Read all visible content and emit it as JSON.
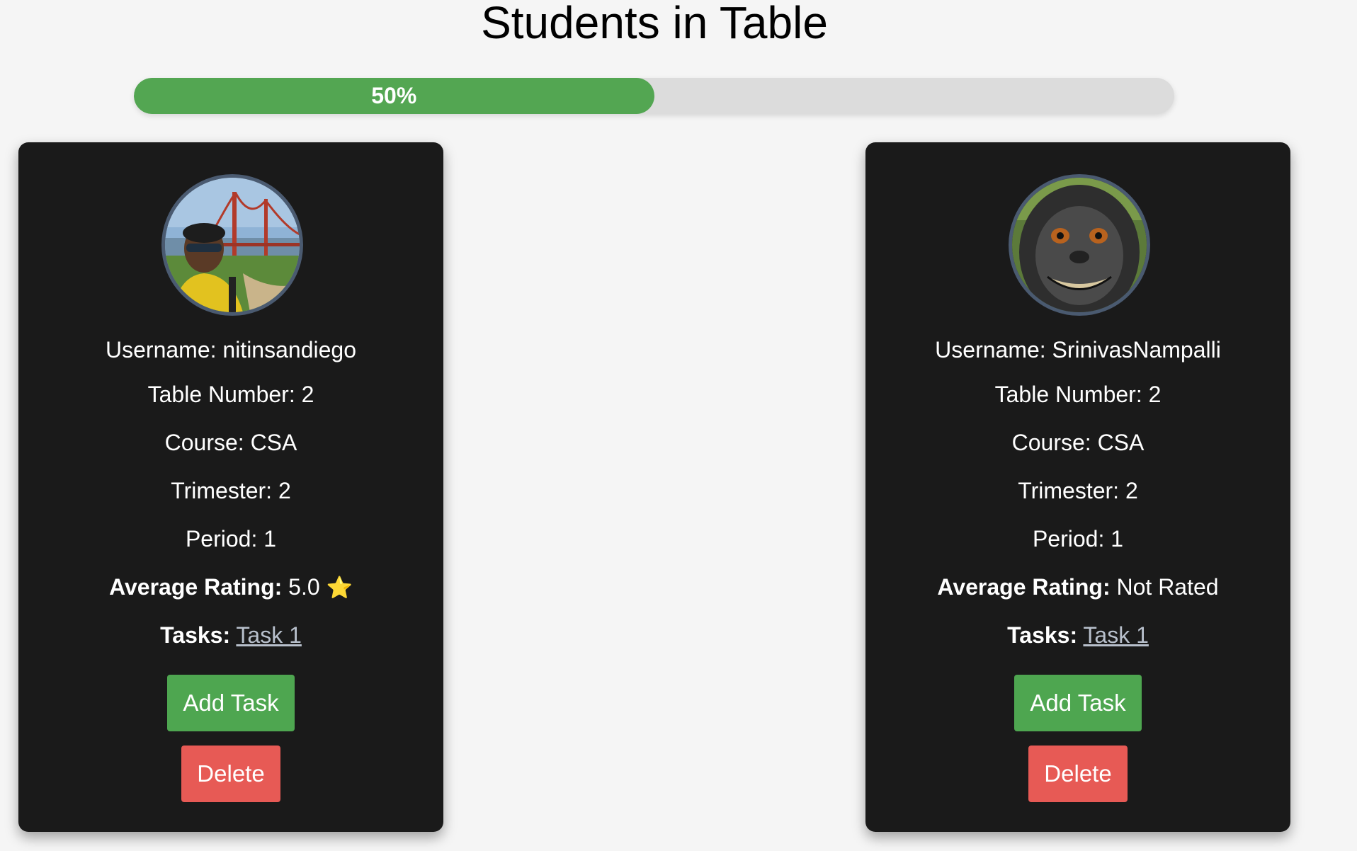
{
  "page": {
    "title": "Students in Table"
  },
  "progress": {
    "value": 0.5,
    "label": "50%",
    "fill_color": "#53a652",
    "track_color": "#dcdcdc"
  },
  "students": [
    {
      "avatar_icon": "student-photo-golden-gate",
      "username_label": "Username: ",
      "username": "nitinsandiego",
      "table_number_label": "Table Number: ",
      "table_number": "2",
      "course_label": "Course: ",
      "course": "CSA",
      "trimester_label": "Trimester: ",
      "trimester": "2",
      "period_label": "Period: ",
      "period": "1",
      "rating_label": "Average Rating:",
      "rating_value": "5.0",
      "rating_star": "⭐",
      "tasks_label": "Tasks:",
      "task_link": "Task 1",
      "add_button": "Add Task",
      "delete_button": "Delete"
    },
    {
      "avatar_icon": "student-photo-monkey",
      "username_label": "Username: ",
      "username": "SrinivasNampalli",
      "table_number_label": "Table Number: ",
      "table_number": "2",
      "course_label": "Course: ",
      "course": "CSA",
      "trimester_label": "Trimester: ",
      "trimester": "2",
      "period_label": "Period: ",
      "period": "1",
      "rating_label": "Average Rating:",
      "rating_value": "Not Rated",
      "rating_star": "",
      "tasks_label": "Tasks:",
      "task_link": "Task 1",
      "add_button": "Add Task",
      "delete_button": "Delete"
    }
  ],
  "colors": {
    "card_background": "#1a1a1a",
    "add_button": "#4ea650",
    "delete_button": "#e75a55",
    "avatar_border": "#4a5a70"
  }
}
